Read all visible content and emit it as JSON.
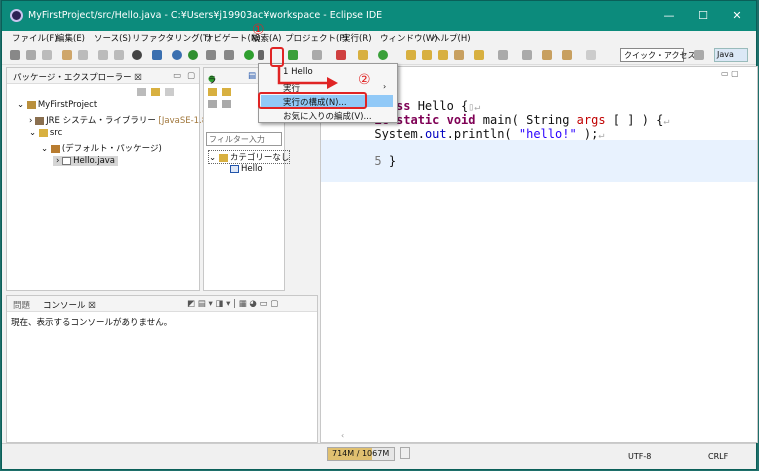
{
  "window": {
    "title": "MyFirstProject/src/Hello.java - C:¥Users¥j19903ac¥workspace - Eclipse IDE"
  },
  "titlebar": {
    "minimize": "—",
    "maximize": "☐",
    "close": "✕"
  },
  "menu": [
    "ファイル(F)",
    "編集(E)",
    "ソース(S)",
    "リファクタリング(T)",
    "ナビゲート(N)",
    "検索(A)",
    "プロジェクト(P)",
    "実行(R)",
    "ウィンドウ(W)",
    "ヘルプ(H)"
  ],
  "toolbar": {
    "quick_access": "クイック・アクセス",
    "perspective": "Java"
  },
  "package_explorer": {
    "tab": "パッケージ・エクスプローラー ☒",
    "project": "MyFirstProject",
    "jre": "JRE システム・ライブラリー",
    "jre_version": "[JavaSE-1.8]",
    "src": "src",
    "default_pkg": "(デフォルト・パッケージ)",
    "file": "Hello.java"
  },
  "outline": {
    "tab": "ラ",
    "filter_placeholder": "フィルター入力",
    "category": "カテゴリーなし",
    "class": "Hello"
  },
  "dropdown": {
    "item1": "1 Hello",
    "item2": "実行",
    "item3": "実行の構成(N)...",
    "item4": "お気に入りの編成(V)..."
  },
  "editor": {
    "line1_kw": "class",
    "line1_rest": " Hello {",
    "line2_mods": "ic static void",
    "line2_main": " main( String ",
    "line2_param": "args",
    "line2_rest": " [ ] ) {",
    "line3_pre": "System.",
    "line3_field": "out",
    "line3_call": ".println( ",
    "line3_str": "\"hello!\"",
    "line3_end": " );",
    "line4_num": "4",
    "line4_code": "    }",
    "line5_num": "5",
    "line5_code": " }"
  },
  "console": {
    "tab_problems": "問題",
    "tab_console": "コンソール ☒",
    "message": "現在、表示するコンソールがありません。"
  },
  "status": {
    "memory": "714M / 1067M",
    "memory_used_fraction": 0.67,
    "encoding": "UTF-8",
    "line_ending": "CRLF"
  },
  "annotations": {
    "step1": "①",
    "step2": "②"
  },
  "colors": {
    "titlebar": "#0c8b7c",
    "accent_red": "#e02424",
    "highlight": "#91c9f7"
  }
}
